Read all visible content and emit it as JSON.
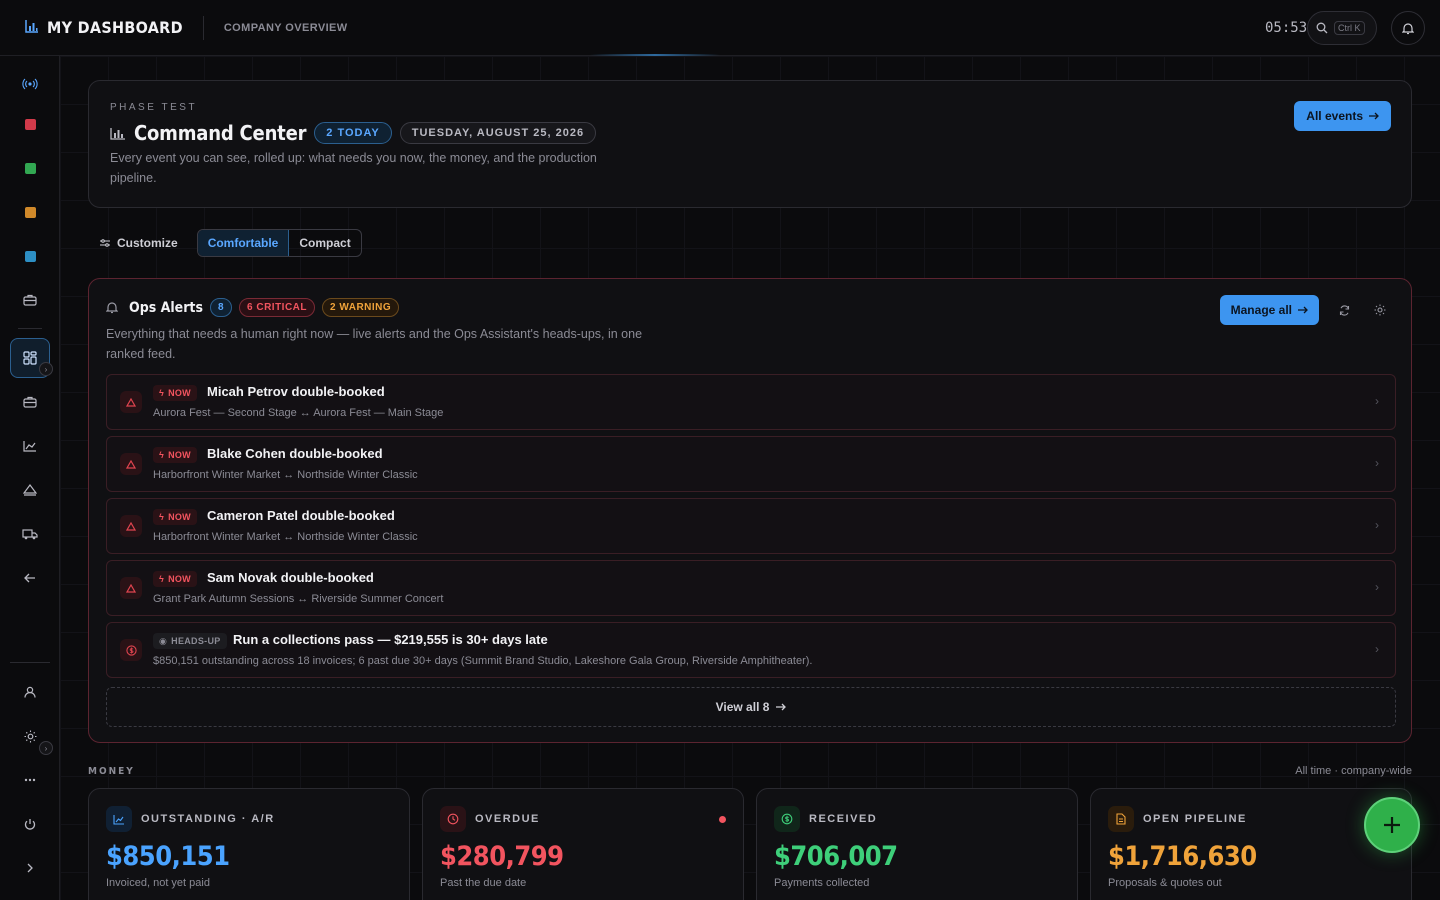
{
  "header": {
    "app_title": "MY DASHBOARD",
    "breadcrumb": "COMPANY OVERVIEW",
    "clock": "05:53",
    "search_shortcut": "Ctrl K"
  },
  "hero": {
    "eyebrow": "PHASE TEST",
    "title": "Command Center",
    "today_badge": "2 TODAY",
    "date_badge": "TUESDAY, AUGUST 25, 2026",
    "description": "Every event you can see, rolled up: what needs you now, the money, and the production pipeline.",
    "all_events_label": "All events"
  },
  "toolbar": {
    "customize_label": "Customize",
    "density_options": [
      "Comfortable",
      "Compact"
    ],
    "density_selected": "Comfortable"
  },
  "ops_alerts": {
    "title": "Ops Alerts",
    "count": "8",
    "critical_label": "6 CRITICAL",
    "warning_label": "2 WARNING",
    "description": "Everything that needs a human right now — live alerts and the Ops Assistant's heads-ups, in one ranked feed.",
    "manage_label": "Manage all",
    "items": [
      {
        "tag": "NOW",
        "title": "Micah Petrov double-booked",
        "subtitle": "Aurora Fest — Second Stage ↔ Aurora Fest — Main Stage"
      },
      {
        "tag": "NOW",
        "title": "Blake Cohen double-booked",
        "subtitle": "Harborfront Winter Market ↔ Northside Winter Classic"
      },
      {
        "tag": "NOW",
        "title": "Cameron Patel double-booked",
        "subtitle": "Harborfront Winter Market ↔ Northside Winter Classic"
      },
      {
        "tag": "NOW",
        "title": "Sam Novak double-booked",
        "subtitle": "Grant Park Autumn Sessions ↔ Riverside Summer Concert"
      },
      {
        "tag": "HEADS-UP",
        "title": "Run a collections pass — $219,555 is 30+ days late",
        "subtitle": "$850,151 outstanding across 18 invoices; 6 past due 30+ days (Summit Brand Studio, Lakeshore Gala Group, Riverside Amphitheater)."
      }
    ],
    "view_all_label": "View all 8"
  },
  "money": {
    "section_label": "MONEY",
    "scope": "All time · company-wide",
    "cards": [
      {
        "label": "OUTSTANDING · A/R",
        "value": "$850,151",
        "sub": "Invoiced, not yet paid",
        "color": "#4aa3ff",
        "icon": "trend-chart-icon"
      },
      {
        "label": "OVERDUE",
        "value": "$280,799",
        "sub": "Past the due date",
        "color": "#f2545f",
        "icon": "clock-icon"
      },
      {
        "label": "RECEIVED",
        "value": "$706,007",
        "sub": "Payments collected",
        "color": "#3ecf7a",
        "icon": "dollar-icon"
      },
      {
        "label": "OPEN PIPELINE",
        "value": "$1,716,630",
        "sub": "Proposals & quotes out",
        "color": "#f0a33a",
        "icon": "document-icon"
      }
    ]
  },
  "colors": {
    "accent": "#3d95f0",
    "critical": "#f2545f",
    "warning": "#f0a33a",
    "success": "#3ecf7a",
    "fab": "#2fb04a"
  }
}
